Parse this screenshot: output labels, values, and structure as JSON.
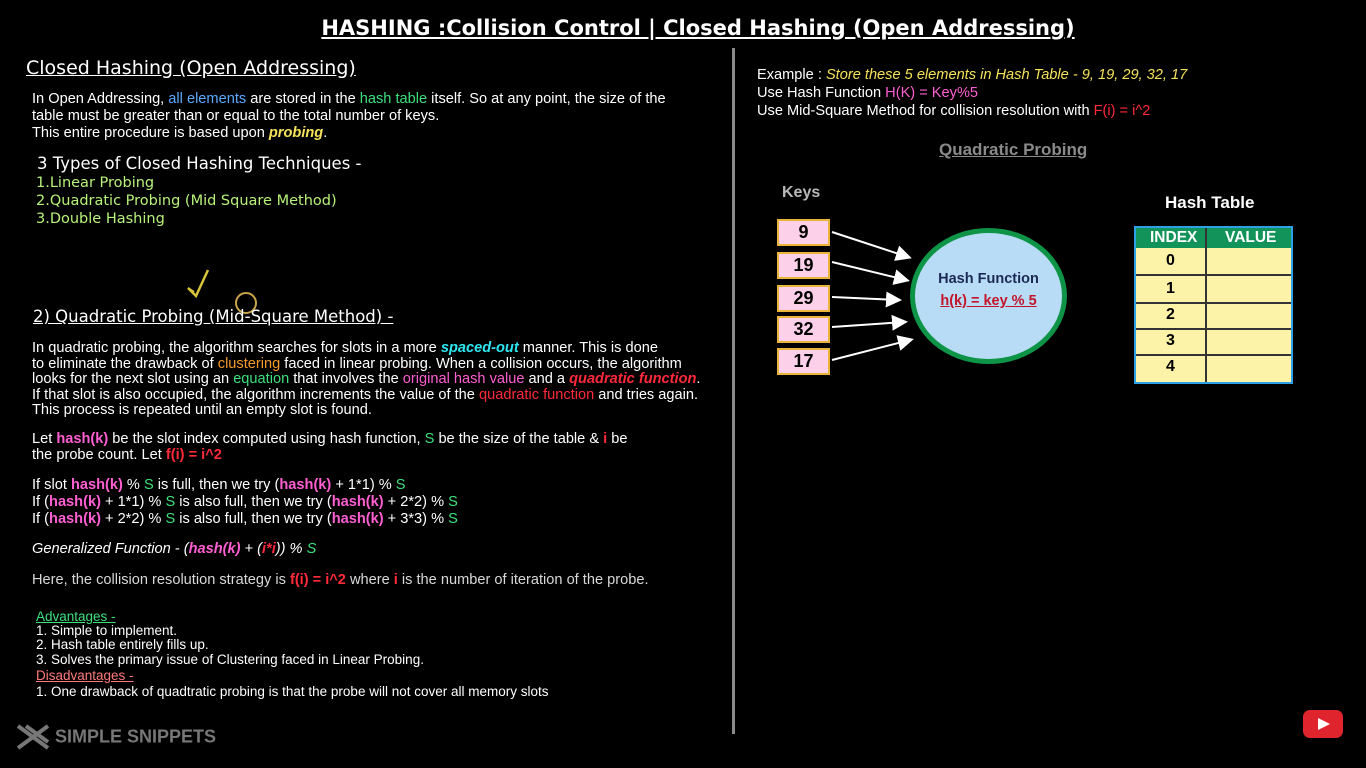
{
  "title": "HASHING :Collision Control | Closed Hashing (Open Addressing)",
  "left": {
    "heading": "Closed Hashing (Open Addressing)",
    "intro": {
      "p1a": "In Open Addressing, ",
      "p1b": "all elements",
      "p1c": " are stored in the ",
      "p1d": "hash table",
      "p1e": " itself. So at any point, the size of the",
      "p2": "table must be greater than or equal to the total number of keys.",
      "p3a": "This entire procedure is based upon ",
      "p3b": "probing",
      "p3c": "."
    },
    "types_heading": "3 Types of Closed Hashing Techniques -",
    "types": [
      "1.Linear Probing",
      "2.Quadratic Probing (Mid Square Method)",
      "3.Double Hashing"
    ],
    "qp_heading": "2) Quadratic Probing (Mid-Square Method) -",
    "desc": {
      "l1a": "In quadratic probing, the algorithm searches for slots in a more ",
      "l1b": "spaced-out",
      "l1c": " manner.  This is done",
      "l2a": "to eliminate the drawback of ",
      "l2b": "clustering",
      "l2c": " faced in linear probing. When a collision occurs, the algorithm",
      "l3a": "looks for the next slot using an ",
      "l3b": "equation",
      "l3c": " that involves the ",
      "l3d": "original hash value",
      "l3e": " and a ",
      "l3f": "quadratic function",
      "l3g": ".",
      "l4a": "If that slot is also occupied, the algorithm increments the value of the ",
      "l4b": "quadratic function",
      "l4c": " and tries again.",
      "l5": "This process is repeated until an empty slot is found."
    },
    "let": {
      "a": "Let ",
      "b": "hash(k)",
      "c": " be the slot index computed using hash function, ",
      "d": "S",
      "e": " be the size of the table & ",
      "f": "i",
      "g": " be",
      "h": "the probe count. Let ",
      "i": "f(i) = i^2"
    },
    "tries": {
      "t1a": "If slot ",
      "t1b": "hash(k)",
      "t1c": " % ",
      "t1d": "S",
      "t1e": " is full, then we try (",
      "t1f": "hash(k)",
      "t1g": " + 1*1) % ",
      "t1h": "S",
      "t2a": "If (",
      "t2b": "hash(k)",
      "t2c": " + 1*1) % ",
      "t2d": "S",
      "t2e": " is also full, then we try (",
      "t2f": "hash(k)",
      "t2g": " + 2*2) % ",
      "t2h": "S",
      "t3a": "If (",
      "t3b": "hash(k)",
      "t3c": " + 2*2) % ",
      "t3d": "S",
      "t3e": " is also full, then we try (",
      "t3f": "hash(k)",
      "t3g": " + 3*3) % ",
      "t3h": "S"
    },
    "general": {
      "a": "Generalized Function - (",
      "b": "hash(k)",
      "c": " + (",
      "d": "i*i",
      "e": ")) % ",
      "f": "S"
    },
    "strategy": {
      "a": "Here, the collision resolution strategy is ",
      "b": "f(i) = i^2",
      "c": " where ",
      "d": "i",
      "e": " is the number of iteration of the probe."
    },
    "advantages_label": "Advantages -",
    "advantages": [
      "1. Simple to implement.",
      "2. Hash table entirely fills up.",
      "3. Solves the primary issue of Clustering faced in Linear Probing."
    ],
    "disadvantages_label": "Disadvantages -",
    "disadvantages": [
      "1. One drawback of quadtratic probing is that the probe will not cover all memory slots"
    ]
  },
  "right": {
    "example": {
      "a": "Example : ",
      "b": "Store these 5 elements in Hash Table - 9, 19, 29, 32, 17"
    },
    "hashfn": {
      "a": "Use Hash Function ",
      "b": "H(K) = Key%5"
    },
    "midsq": {
      "a": "Use Mid-Square Method for collision resolution with ",
      "b": "F(i) = i^2"
    },
    "diagram_title": "Quadratic Probing",
    "keys_label": "Keys",
    "keys": [
      "9",
      "19",
      "29",
      "32",
      "17"
    ],
    "hash_function_label": "Hash Function",
    "hash_function_formula": "h(k) = key % 5",
    "hash_table_label": "Hash Table",
    "table_headers": [
      "INDEX",
      "VALUE"
    ],
    "indices": [
      "0",
      "1",
      "2",
      "3",
      "4"
    ]
  },
  "branding": {
    "logo_text": "SIMPLE SNIPPETS"
  },
  "colors": {
    "background": "#000000",
    "hash_table_header": "#12935a",
    "circle_fill": "#b9dcf6",
    "key_box": "#fbd0e8"
  },
  "icons": [
    "pen-cursor-icon",
    "youtube-play-icon",
    "logo-x-icon"
  ]
}
